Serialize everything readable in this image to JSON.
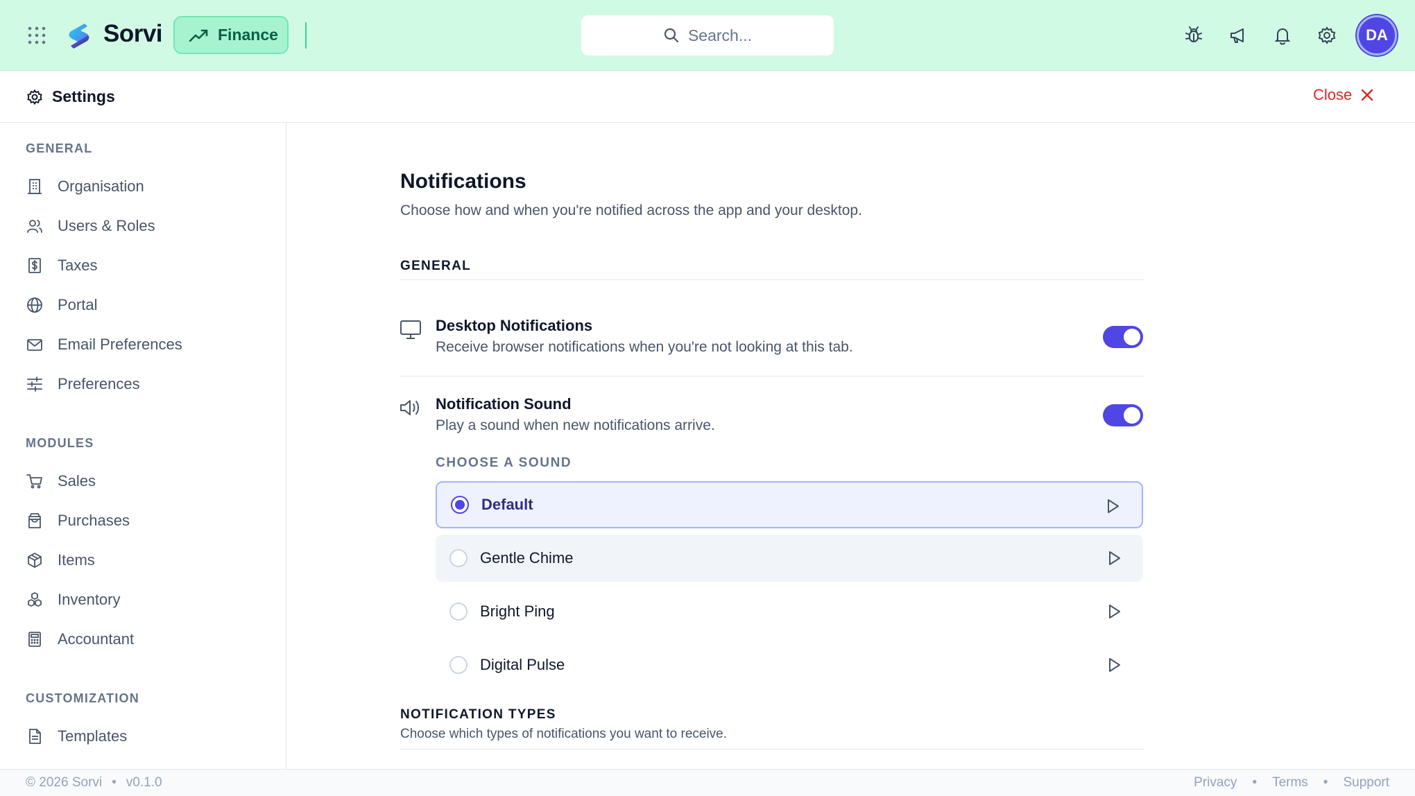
{
  "app": {
    "brand": "Sorvi",
    "module": "Finance",
    "user_initials": "DA"
  },
  "topbar": {
    "search_placeholder": "Search...",
    "icons": [
      "apps-grid-icon",
      "bug-icon",
      "megaphone-icon",
      "bell-icon",
      "gear-icon"
    ]
  },
  "settings_header": {
    "title": "Settings",
    "close_label": "Close"
  },
  "sidebar": {
    "general_heading": "GENERAL",
    "general_items": [
      {
        "label": "Organisation",
        "icon": "building-icon"
      },
      {
        "label": "Users & Roles",
        "icon": "users-icon"
      },
      {
        "label": "Taxes",
        "icon": "dollar-receipt-icon"
      },
      {
        "label": "Portal",
        "icon": "globe-icon"
      },
      {
        "label": "Email Preferences",
        "icon": "mail-icon"
      },
      {
        "label": "Preferences",
        "icon": "sliders-icon"
      }
    ],
    "modules_heading": "MODULES",
    "module_items": [
      {
        "label": "Sales",
        "icon": "cart-icon"
      },
      {
        "label": "Purchases",
        "icon": "shopping-bag-icon"
      },
      {
        "label": "Items",
        "icon": "package-icon"
      },
      {
        "label": "Inventory",
        "icon": "boxes-icon"
      },
      {
        "label": "Accountant",
        "icon": "calculator-icon"
      }
    ],
    "customization_heading": "CUSTOMIZATION",
    "customization_items": [
      {
        "label": "Templates",
        "icon": "document-icon"
      }
    ]
  },
  "main": {
    "title": "Notifications",
    "subtitle": "Choose how and when you're notified across the app and your desktop.",
    "general_heading": "GENERAL",
    "desktop": {
      "title": "Desktop Notifications",
      "desc": "Receive browser notifications when you're not looking at this tab.",
      "enabled": true
    },
    "sound": {
      "title": "Notification Sound",
      "desc": "Play a sound when new notifications arrive.",
      "enabled": true,
      "choose_label": "CHOOSE A SOUND",
      "options": [
        "Default",
        "Gentle Chime",
        "Bright Ping",
        "Digital Pulse"
      ],
      "selected": "Default"
    },
    "types_heading": "NOTIFICATION TYPES",
    "types_desc": "Choose which types of notifications you want to receive."
  },
  "footer": {
    "copyright": "© 2026 Sorvi",
    "version": "v0.1.0",
    "links": [
      "Privacy",
      "Terms",
      "Support"
    ]
  },
  "colors": {
    "topbar_bg": "#d1fae5",
    "accent": "#4f46e5",
    "finance_green": "#065f46",
    "close_red": "#dc2626"
  }
}
